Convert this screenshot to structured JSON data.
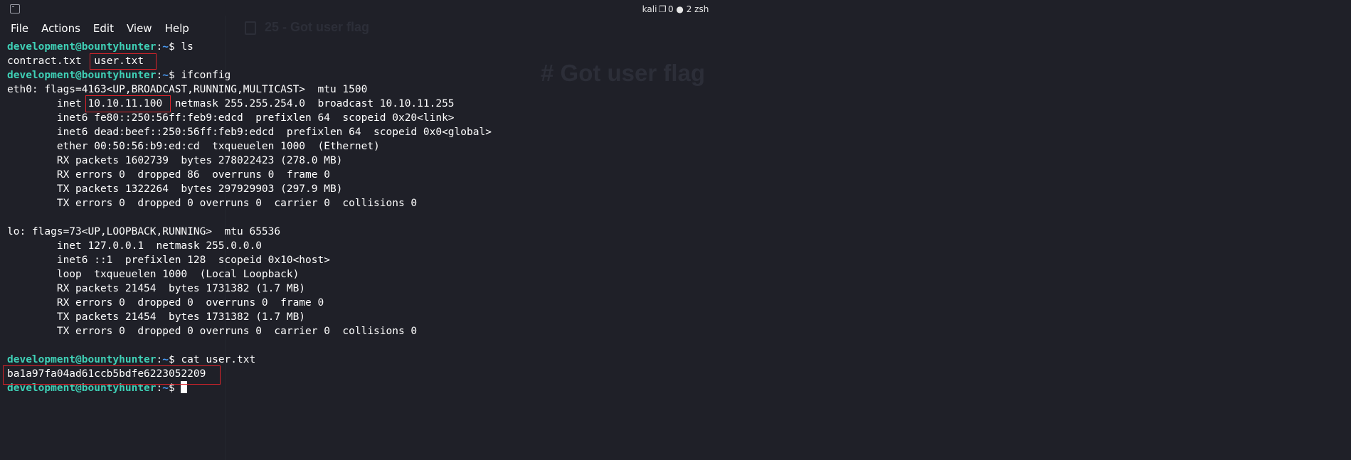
{
  "window": {
    "title": "kali ❐ 0 ● 2 zsh"
  },
  "menu": [
    "File",
    "Actions",
    "Edit",
    "View",
    "Help"
  ],
  "background_app": {
    "tab_title": "25 - Got user flag",
    "heading": "# Got user flag"
  },
  "terminal": {
    "prompt": {
      "user": "development@bountyhunter",
      "sep": ":",
      "path": "~",
      "dollar": "$ "
    },
    "commands": {
      "ls": "ls",
      "ifconfig": "ifconfig",
      "cat": "cat user.txt"
    },
    "ls_output": {
      "file1": "contract.txt",
      "file2": "user.txt"
    },
    "ifconfig_output": [
      "eth0: flags=4163<UP,BROADCAST,RUNNING,MULTICAST>  mtu 1500",
      "        inet 10.10.11.100  netmask 255.255.254.0  broadcast 10.10.11.255",
      "        inet6 fe80::250:56ff:feb9:edcd  prefixlen 64  scopeid 0x20<link>",
      "        inet6 dead:beef::250:56ff:feb9:edcd  prefixlen 64  scopeid 0x0<global>",
      "        ether 00:50:56:b9:ed:cd  txqueuelen 1000  (Ethernet)",
      "        RX packets 1602739  bytes 278022423 (278.0 MB)",
      "        RX errors 0  dropped 86  overruns 0  frame 0",
      "        TX packets 1322264  bytes 297929903 (297.9 MB)",
      "        TX errors 0  dropped 0 overruns 0  carrier 0  collisions 0",
      "",
      "lo: flags=73<UP,LOOPBACK,RUNNING>  mtu 65536",
      "        inet 127.0.0.1  netmask 255.0.0.0",
      "        inet6 ::1  prefixlen 128  scopeid 0x10<host>",
      "        loop  txqueuelen 1000  (Local Loopback)",
      "        RX packets 21454  bytes 1731382 (1.7 MB)",
      "        RX errors 0  dropped 0  overruns 0  frame 0",
      "        TX packets 21454  bytes 1731382 (1.7 MB)",
      "        TX errors 0  dropped 0 overruns 0  carrier 0  collisions 0",
      ""
    ],
    "flag_output": "ba1a97fa04ad61ccb5bdfe6223052209"
  },
  "colors": {
    "background": "#1f2028",
    "prompt_user": "#3fd0b6",
    "prompt_path": "#4a9cf6",
    "highlight_box": "#d8232a"
  }
}
